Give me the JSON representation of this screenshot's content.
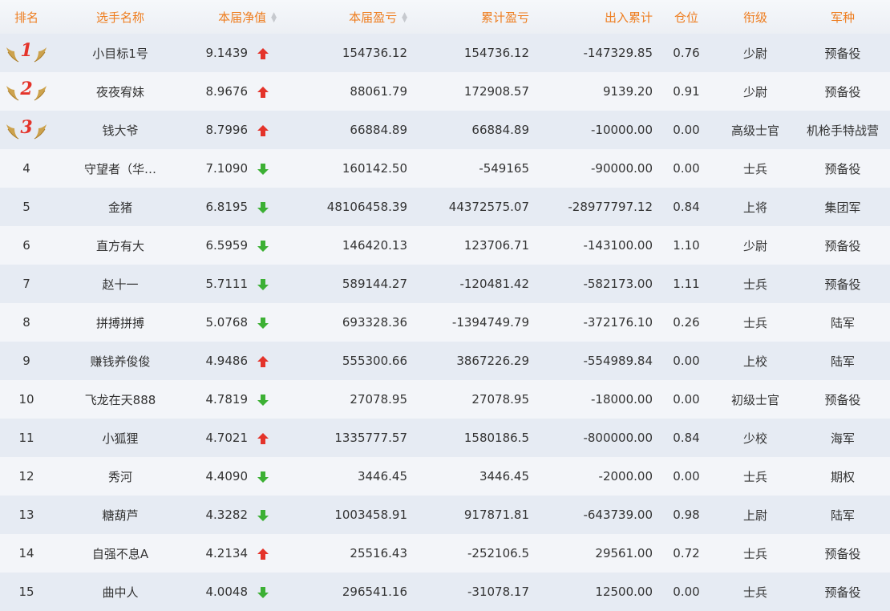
{
  "headers": {
    "rank": "排名",
    "name": "选手名称",
    "nav": "本届净值",
    "session_pl": "本届盈亏",
    "cumulative_pl": "累计盈亏",
    "inout": "出入累计",
    "position": "仓位",
    "title": "衔级",
    "branch": "军种"
  },
  "sort_icon": "sort-updown-icon",
  "colors": {
    "header_text": "#ee7d1f",
    "row_odd": "#e6ebf3",
    "row_even": "#f3f5f9",
    "up": "#e4332a",
    "down": "#3cb034",
    "medal_number": "#e4332a",
    "wing": "#c99a3b"
  },
  "rows": [
    {
      "rank": "1",
      "medal": true,
      "name": "小目标1号",
      "nav": "9.1439",
      "trend": "up",
      "session_pl": "154736.12",
      "cumulative_pl": "154736.12",
      "inout": "-147329.85",
      "position": "0.76",
      "title": "少尉",
      "branch": "预备役"
    },
    {
      "rank": "2",
      "medal": true,
      "name": "夜夜宥妹",
      "nav": "8.9676",
      "trend": "up",
      "session_pl": "88061.79",
      "cumulative_pl": "172908.57",
      "inout": "9139.20",
      "position": "0.91",
      "title": "少尉",
      "branch": "预备役"
    },
    {
      "rank": "3",
      "medal": true,
      "name": "钱大爷",
      "nav": "8.7996",
      "trend": "up",
      "session_pl": "66884.89",
      "cumulative_pl": "66884.89",
      "inout": "-10000.00",
      "position": "0.00",
      "title": "高级士官",
      "branch": "机枪手特战营"
    },
    {
      "rank": "4",
      "medal": false,
      "name": "守望者（华…",
      "nav": "7.1090",
      "trend": "down",
      "session_pl": "160142.50",
      "cumulative_pl": "-549165",
      "inout": "-90000.00",
      "position": "0.00",
      "title": "士兵",
      "branch": "预备役"
    },
    {
      "rank": "5",
      "medal": false,
      "name": "金猪",
      "nav": "6.8195",
      "trend": "down",
      "session_pl": "48106458.39",
      "cumulative_pl": "44372575.07",
      "inout": "-28977797.12",
      "position": "0.84",
      "title": "上将",
      "branch": "集团军"
    },
    {
      "rank": "6",
      "medal": false,
      "name": "直方有大",
      "nav": "6.5959",
      "trend": "down",
      "session_pl": "146420.13",
      "cumulative_pl": "123706.71",
      "inout": "-143100.00",
      "position": "1.10",
      "title": "少尉",
      "branch": "预备役"
    },
    {
      "rank": "7",
      "medal": false,
      "name": "赵十一",
      "nav": "5.7111",
      "trend": "down",
      "session_pl": "589144.27",
      "cumulative_pl": "-120481.42",
      "inout": "-582173.00",
      "position": "1.11",
      "title": "士兵",
      "branch": "预备役"
    },
    {
      "rank": "8",
      "medal": false,
      "name": "拼搏拼搏",
      "nav": "5.0768",
      "trend": "down",
      "session_pl": "693328.36",
      "cumulative_pl": "-1394749.79",
      "inout": "-372176.10",
      "position": "0.26",
      "title": "士兵",
      "branch": "陆军"
    },
    {
      "rank": "9",
      "medal": false,
      "name": "赚钱养俊俊",
      "nav": "4.9486",
      "trend": "up",
      "session_pl": "555300.66",
      "cumulative_pl": "3867226.29",
      "inout": "-554989.84",
      "position": "0.00",
      "title": "上校",
      "branch": "陆军"
    },
    {
      "rank": "10",
      "medal": false,
      "name": "飞龙在天888",
      "nav": "4.7819",
      "trend": "down",
      "session_pl": "27078.95",
      "cumulative_pl": "27078.95",
      "inout": "-18000.00",
      "position": "0.00",
      "title": "初级士官",
      "branch": "预备役"
    },
    {
      "rank": "11",
      "medal": false,
      "name": "小狐狸",
      "nav": "4.7021",
      "trend": "up",
      "session_pl": "1335777.57",
      "cumulative_pl": "1580186.5",
      "inout": "-800000.00",
      "position": "0.84",
      "title": "少校",
      "branch": "海军"
    },
    {
      "rank": "12",
      "medal": false,
      "name": "秀河",
      "nav": "4.4090",
      "trend": "down",
      "session_pl": "3446.45",
      "cumulative_pl": "3446.45",
      "inout": "-2000.00",
      "position": "0.00",
      "title": "士兵",
      "branch": "期权"
    },
    {
      "rank": "13",
      "medal": false,
      "name": "糖葫芦",
      "nav": "4.3282",
      "trend": "down",
      "session_pl": "1003458.91",
      "cumulative_pl": "917871.81",
      "inout": "-643739.00",
      "position": "0.98",
      "title": "上尉",
      "branch": "陆军"
    },
    {
      "rank": "14",
      "medal": false,
      "name": "自强不息A",
      "nav": "4.2134",
      "trend": "up",
      "session_pl": "25516.43",
      "cumulative_pl": "-252106.5",
      "inout": "29561.00",
      "position": "0.72",
      "title": "士兵",
      "branch": "预备役"
    },
    {
      "rank": "15",
      "medal": false,
      "name": "曲中人",
      "nav": "4.0048",
      "trend": "down",
      "session_pl": "296541.16",
      "cumulative_pl": "-31078.17",
      "inout": "12500.00",
      "position": "0.00",
      "title": "士兵",
      "branch": "预备役"
    }
  ]
}
